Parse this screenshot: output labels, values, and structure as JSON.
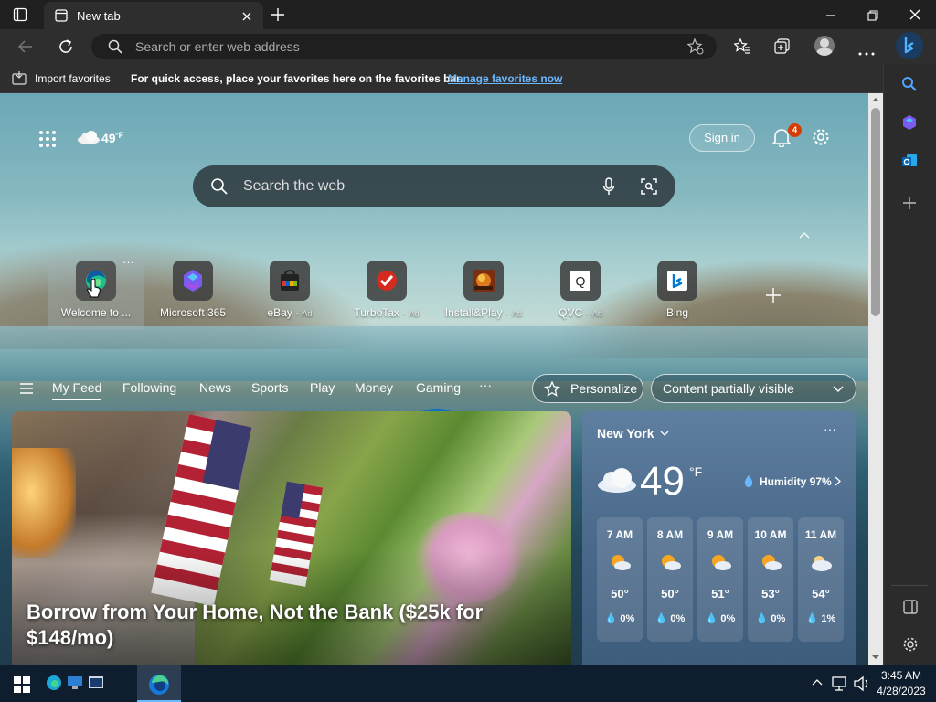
{
  "window": {
    "tab_title": "New tab"
  },
  "address_bar": {
    "placeholder": "Search or enter web address"
  },
  "favorites_bar": {
    "import_label": "Import favorites",
    "message": "For quick access, place your favorites here on the favorites bar.",
    "manage_link": "Manage favorites now"
  },
  "newtab": {
    "weather_mini": {
      "temp": "49",
      "unit": "°F"
    },
    "search_placeholder": "Search the web",
    "signin_label": "Sign in",
    "notification_count": "4",
    "quick_links": [
      {
        "label": "Welcome to ...",
        "ad": ""
      },
      {
        "label": "Microsoft 365",
        "ad": ""
      },
      {
        "label": "eBay",
        "ad": "Ad"
      },
      {
        "label": "TurboTax",
        "ad": "Ad"
      },
      {
        "label": "Install&Play",
        "ad": "Ad"
      },
      {
        "label": "QVC",
        "ad": "Ad"
      },
      {
        "label": "Bing",
        "ad": ""
      }
    ],
    "feed_tabs": [
      "My Feed",
      "Following",
      "News",
      "Sports",
      "Play",
      "Money",
      "Gaming"
    ],
    "personalize_label": "Personalize",
    "content_visibility": "Content partially visible"
  },
  "hero_article": {
    "headline": "Borrow from Your Home, Not the Bank ($25k for $148/mo)"
  },
  "weather_card": {
    "location": "New York",
    "temp": "49",
    "unit": "°F",
    "humidity": "Humidity 97%",
    "hourly": [
      {
        "time": "7 AM",
        "temp": "50°",
        "precip": "0%",
        "icon": "partly-sunny-icon"
      },
      {
        "time": "8 AM",
        "temp": "50°",
        "precip": "0%",
        "icon": "partly-sunny-icon"
      },
      {
        "time": "9 AM",
        "temp": "51°",
        "precip": "0%",
        "icon": "partly-sunny-icon"
      },
      {
        "time": "10 AM",
        "temp": "53°",
        "precip": "0%",
        "icon": "partly-sunny-icon"
      },
      {
        "time": "11 AM",
        "temp": "54°",
        "precip": "1%",
        "icon": "cloudy-icon"
      }
    ]
  },
  "taskbar": {
    "time": "3:45 AM",
    "date": "4/28/2023"
  },
  "colors": {
    "accent": "#0078d4",
    "link": "#6cb8ff",
    "badge": "#d83b01"
  }
}
